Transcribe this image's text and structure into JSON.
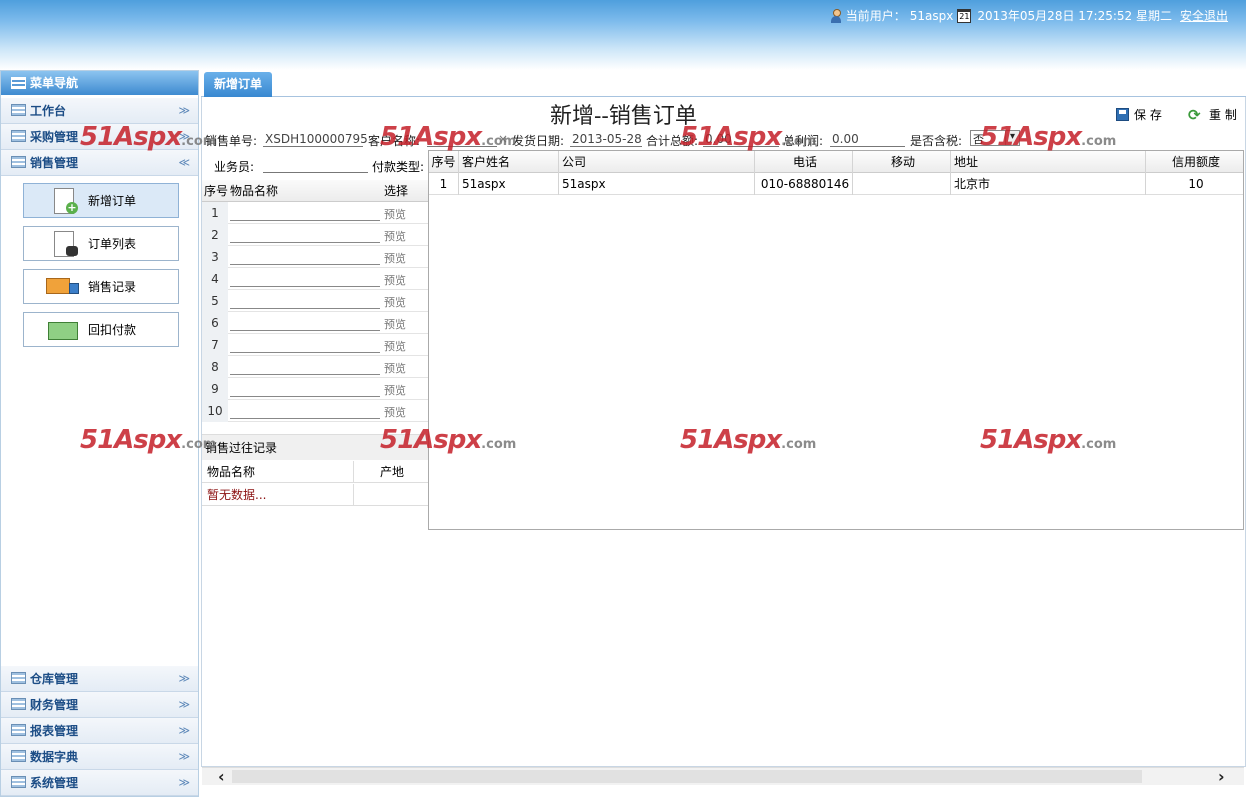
{
  "header": {
    "user_label": "当前用户：",
    "user_name": "51aspx",
    "calendar_day": "21",
    "datetime": "2013年05月28日 17:25:52 星期二",
    "logout": "安全退出"
  },
  "sidebar": {
    "title": "菜单导航",
    "top_groups": [
      {
        "label": "工作台",
        "chevron": "≫"
      },
      {
        "label": "采购管理",
        "chevron": "≫"
      },
      {
        "label": "销售管理",
        "chevron": "≪"
      }
    ],
    "buttons": [
      {
        "label": "新增订单",
        "icon": "new-order-icon"
      },
      {
        "label": "订单列表",
        "icon": "order-list-icon"
      },
      {
        "label": "销售记录",
        "icon": "truck-icon"
      },
      {
        "label": "回扣付款",
        "icon": "money-icon"
      }
    ],
    "bottom_groups": [
      {
        "label": "仓库管理",
        "chevron": "≫"
      },
      {
        "label": "财务管理",
        "chevron": "≫"
      },
      {
        "label": "报表管理",
        "chevron": "≫"
      },
      {
        "label": "数据字典",
        "chevron": "≫"
      },
      {
        "label": "系统管理",
        "chevron": "≫"
      }
    ]
  },
  "tab": {
    "label": "新增订单"
  },
  "form": {
    "title": "新增--销售订单",
    "save": "保 存",
    "reset": "重 制",
    "order_no_label": "销售单号:",
    "order_no": "XSDH100000795",
    "customer_label": "客户名称:",
    "customer_value": "",
    "customer_clear": "×",
    "ship_date_label": "发货日期:",
    "ship_date": "2013-05-28",
    "total_label": "合计总额:",
    "total": "0.00",
    "profit_label": "总利润:",
    "profit": "0.00",
    "tax_label": "是否含税:",
    "tax_value": "否",
    "salesman_label": "业务员:",
    "payment_label": "付款类型:"
  },
  "items": {
    "col_no": "序号",
    "col_name": "物品名称",
    "col_select": "选择",
    "preview": "预览",
    "rows": [
      "1",
      "2",
      "3",
      "4",
      "5",
      "6",
      "7",
      "8",
      "9",
      "10"
    ]
  },
  "history": {
    "title": "销售过往记录",
    "col_name": "物品名称",
    "col_origin": "产地",
    "empty": "暂无数据..."
  },
  "customer_popup": {
    "columns": [
      "序号",
      "客户姓名",
      "公司",
      "电话",
      "移动",
      "地址",
      "信用额度"
    ],
    "rows": [
      {
        "no": "1",
        "name": "51aspx",
        "company": "51aspx",
        "phone": "010-68880146",
        "mobile": "",
        "address": "北京市",
        "credit": "10"
      }
    ]
  },
  "watermark": {
    "brand": "51Aspx",
    "suffix": ".com"
  },
  "scroll": {
    "left": "‹",
    "right": "›"
  },
  "colors": {
    "accent": "#3888d1",
    "watermark": "#c41e28",
    "empty_text": "#8b1010"
  }
}
